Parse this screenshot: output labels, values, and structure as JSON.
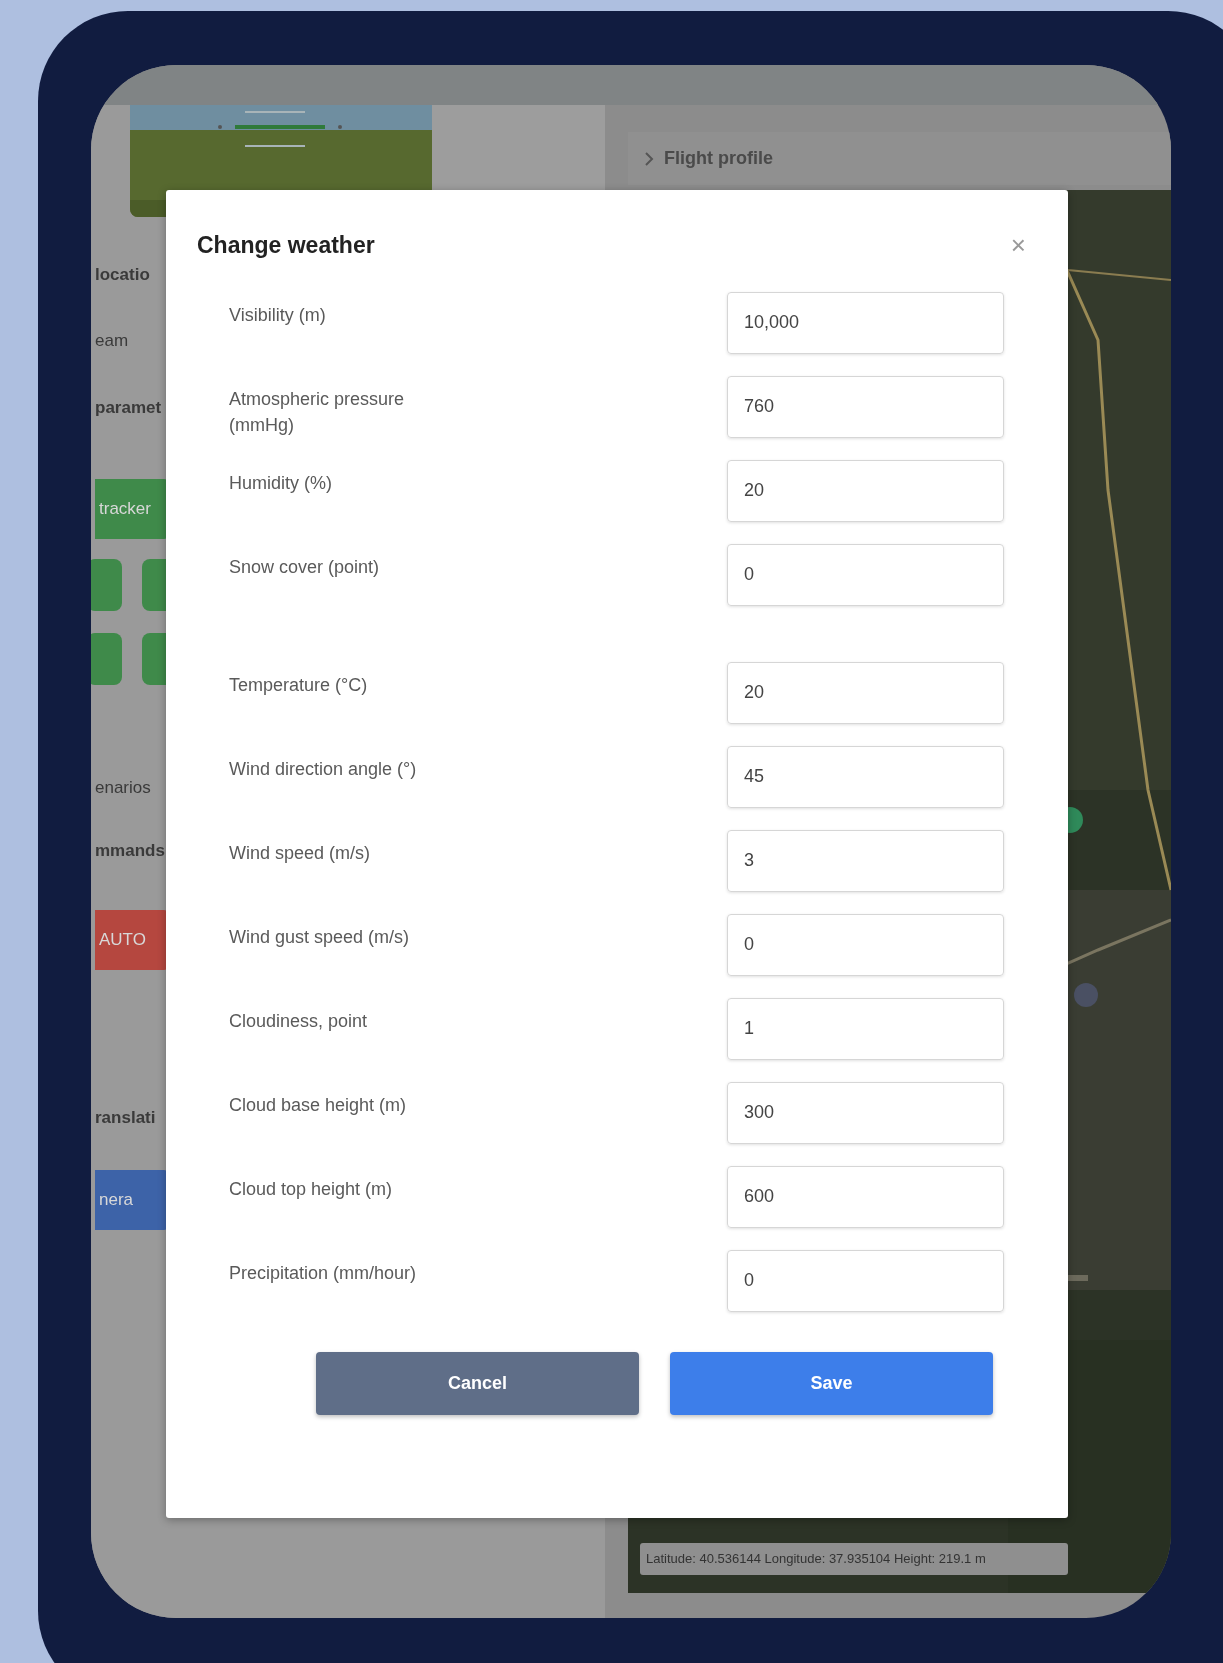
{
  "background": {
    "side_panel": {
      "items": [
        {
          "kind": "text",
          "label": "locatio",
          "bold": true
        },
        {
          "kind": "text",
          "label": "eam",
          "bold": false
        },
        {
          "kind": "text",
          "label": "paramet",
          "bold": true
        },
        {
          "kind": "button",
          "label": "tracker",
          "color": "#3f8a4a"
        },
        {
          "kind": "tiles",
          "color": "#3f8a4a"
        },
        {
          "kind": "tiles",
          "color": "#3f8a4a"
        },
        {
          "kind": "text",
          "label": "enarios",
          "bold": false
        },
        {
          "kind": "text",
          "label": "mmands",
          "bold": true
        },
        {
          "kind": "button",
          "label": "AUTO",
          "color": "#b5473f"
        },
        {
          "kind": "text",
          "label": "ranslati",
          "bold": true
        },
        {
          "kind": "button",
          "label": "nera",
          "color": "#3d63a8"
        }
      ]
    },
    "flight_profile": {
      "title": "Flight profile",
      "expanded": false
    },
    "map": {
      "kind": "picture",
      "status": "Latitude: 40.536144 Longitude: 37.935104 Height: 219.1 m"
    }
  },
  "dialog": {
    "title": "Change weather",
    "close": "×",
    "field_groups": [
      [
        {
          "label": "Visibility (m)",
          "value": "10,000"
        },
        {
          "label": "Atmospheric pressure (mmHg)",
          "value": "760"
        },
        {
          "label": "Humidity (%)",
          "value": "20"
        },
        {
          "label": "Snow cover (point)",
          "value": "0"
        }
      ],
      [
        {
          "label": "Temperature (°C)",
          "value": "20"
        },
        {
          "label": "Wind direction angle (°)",
          "value": "45"
        },
        {
          "label": "Wind speed (m/s)",
          "value": "3"
        },
        {
          "label": "Wind gust speed (m/s)",
          "value": "0"
        },
        {
          "label": "Cloudiness, point",
          "value": "1"
        },
        {
          "label": "Cloud base height (m)",
          "value": "300"
        },
        {
          "label": "Cloud top height (m)",
          "value": "600"
        },
        {
          "label": "Precipitation (mm/hour)",
          "value": "0"
        }
      ]
    ],
    "buttons": [
      {
        "label": "Cancel",
        "kind": "secondary"
      },
      {
        "label": "Save",
        "kind": "primary"
      }
    ]
  }
}
